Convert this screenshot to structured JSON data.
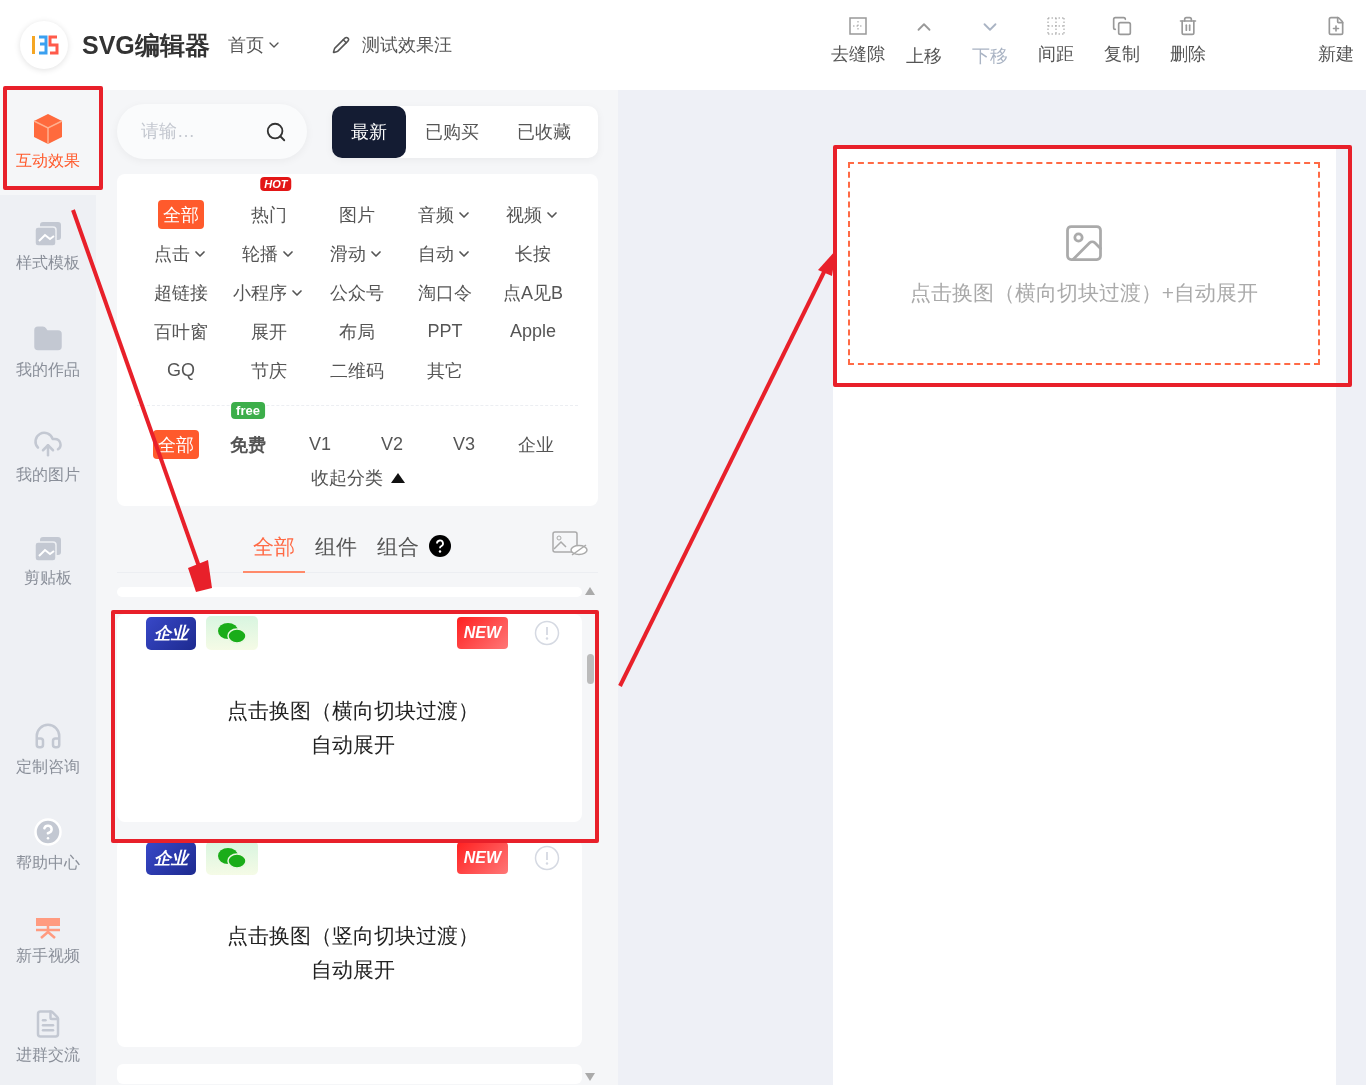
{
  "header": {
    "app_title": "SVG编辑器",
    "home_menu": "首页",
    "doc_title": "测试效果汪"
  },
  "toolbar": [
    {
      "kind": "gap",
      "label": "去缝隙",
      "disabled": false
    },
    {
      "kind": "up",
      "label": "上移",
      "disabled": false
    },
    {
      "kind": "down",
      "label": "下移",
      "disabled": true
    },
    {
      "kind": "spacing",
      "label": "间距",
      "disabled": false
    },
    {
      "kind": "copy",
      "label": "复制",
      "disabled": false
    },
    {
      "kind": "delete",
      "label": "删除",
      "disabled": false
    },
    {
      "kind": "new",
      "label": "新建",
      "disabled": false
    }
  ],
  "sidebar": {
    "items": [
      {
        "kind": "cube",
        "label": "互动效果",
        "selected": true
      },
      {
        "kind": "template",
        "label": "样式模板",
        "selected": false
      },
      {
        "kind": "folder",
        "label": "我的作品",
        "selected": false
      },
      {
        "kind": "cloud",
        "label": "我的图片",
        "selected": false
      },
      {
        "kind": "template",
        "label": "剪贴板",
        "selected": false
      }
    ],
    "help_items": [
      {
        "kind": "headset",
        "label": "定制咨询"
      },
      {
        "kind": "help",
        "label": "帮助中心"
      },
      {
        "kind": "video",
        "label": "新手视频"
      },
      {
        "kind": "doc",
        "label": "进群交流"
      }
    ]
  },
  "search": {
    "placeholder": "请输…"
  },
  "filter_tabs": [
    {
      "label": "最新",
      "selected": true
    },
    {
      "label": "已购买",
      "selected": false
    },
    {
      "label": "已收藏",
      "selected": false
    }
  ],
  "categories": [
    {
      "label": "全部",
      "selected": true,
      "dropdown": false
    },
    {
      "label": "热门",
      "selected": false,
      "dropdown": false,
      "badge": "HOT"
    },
    {
      "label": "图片",
      "selected": false,
      "dropdown": false
    },
    {
      "label": "音频",
      "selected": false,
      "dropdown": true
    },
    {
      "label": "视频",
      "selected": false,
      "dropdown": true
    },
    {
      "label": "点击",
      "selected": false,
      "dropdown": true
    },
    {
      "label": "轮播",
      "selected": false,
      "dropdown": true
    },
    {
      "label": "滑动",
      "selected": false,
      "dropdown": true
    },
    {
      "label": "自动",
      "selected": false,
      "dropdown": true
    },
    {
      "label": "长按",
      "selected": false,
      "dropdown": false
    },
    {
      "label": "超链接",
      "selected": false,
      "dropdown": false
    },
    {
      "label": "小程序",
      "selected": false,
      "dropdown": true
    },
    {
      "label": "公众号",
      "selected": false,
      "dropdown": false
    },
    {
      "label": "淘口令",
      "selected": false,
      "dropdown": false
    },
    {
      "label": "点A见B",
      "selected": false,
      "dropdown": false
    },
    {
      "label": "百叶窗",
      "selected": false,
      "dropdown": false
    },
    {
      "label": "展开",
      "selected": false,
      "dropdown": false
    },
    {
      "label": "布局",
      "selected": false,
      "dropdown": false
    },
    {
      "label": "PPT",
      "selected": false,
      "dropdown": false
    },
    {
      "label": "Apple",
      "selected": false,
      "dropdown": false
    },
    {
      "label": "GQ",
      "selected": false,
      "dropdown": false
    },
    {
      "label": "节庆",
      "selected": false,
      "dropdown": false
    },
    {
      "label": "二维码",
      "selected": false,
      "dropdown": false
    },
    {
      "label": "其它",
      "selected": false,
      "dropdown": false
    }
  ],
  "versions": [
    {
      "label": "全部",
      "selected": true,
      "bold": false
    },
    {
      "label": "免费",
      "selected": false,
      "bold": true,
      "badge": "free"
    },
    {
      "label": "V1",
      "selected": false,
      "bold": false
    },
    {
      "label": "V2",
      "selected": false,
      "bold": false
    },
    {
      "label": "V3",
      "selected": false,
      "bold": false
    },
    {
      "label": "企业",
      "selected": false,
      "bold": false
    }
  ],
  "collapse": "收起分类",
  "content_tabs": [
    {
      "label": "全部",
      "selected": true
    },
    {
      "label": "组件",
      "selected": false
    },
    {
      "label": "组合",
      "selected": false
    }
  ],
  "cards": [
    {
      "tier": "企业",
      "new_badge": "NEW",
      "title_lines": [
        "点击换图（横向切块过渡）",
        "自动展开"
      ]
    },
    {
      "tier": "企业",
      "new_badge": "NEW",
      "title_lines": [
        "点击换图（竖向切块过渡）",
        "自动展开"
      ]
    }
  ],
  "canvas": {
    "placeholder_text": "点击换图（横向切块过渡）+自动展开"
  }
}
